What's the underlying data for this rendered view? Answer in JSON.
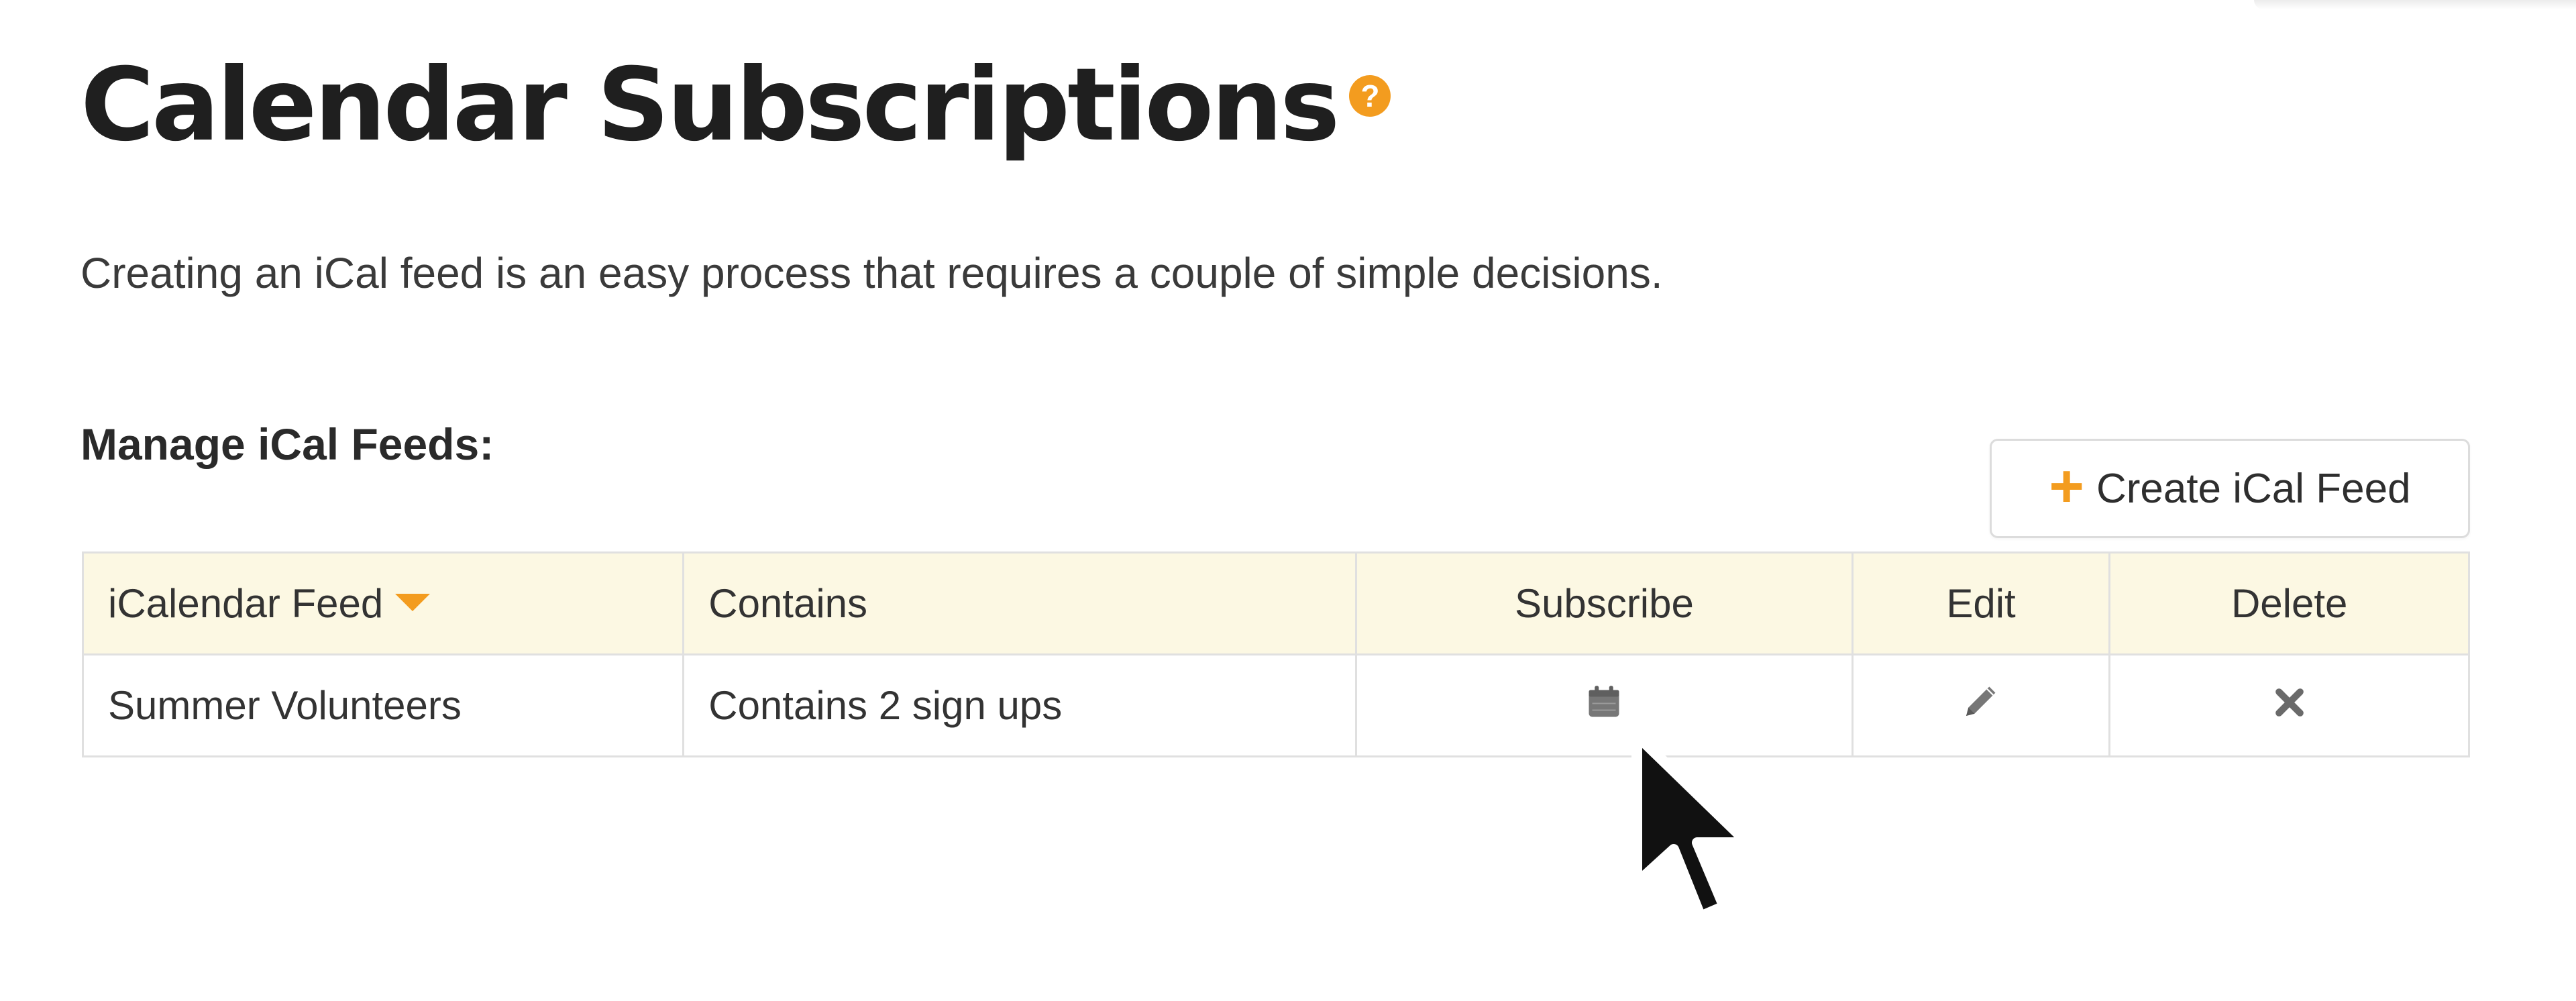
{
  "colors": {
    "accent": "#f39c1f",
    "header_bg": "#fcf8e3",
    "border": "#e0e0e0",
    "icon_gray": "#777777"
  },
  "page": {
    "title": "Calendar Subscriptions",
    "help_icon": "question-circle-icon",
    "help_symbol": "?",
    "intro": "Creating an iCal feed is an easy process that requires a couple of simple decisions."
  },
  "manage": {
    "heading": "Manage iCal Feeds:",
    "create_button": {
      "icon": "plus-icon",
      "symbol": "+",
      "label": "Create iCal Feed"
    }
  },
  "table": {
    "columns": [
      "iCalendar Feed",
      "Contains",
      "Subscribe",
      "Edit",
      "Delete"
    ],
    "sort_column": "iCalendar Feed",
    "sort_icon": "caret-down-icon",
    "rows": [
      {
        "feed": "Summer Volunteers",
        "contains": "Contains 2 sign ups",
        "subscribe_icon": "calendar-icon",
        "edit_icon": "pencil-icon",
        "delete_icon": "close-icon"
      }
    ]
  },
  "pointer": "mouse-cursor-icon"
}
